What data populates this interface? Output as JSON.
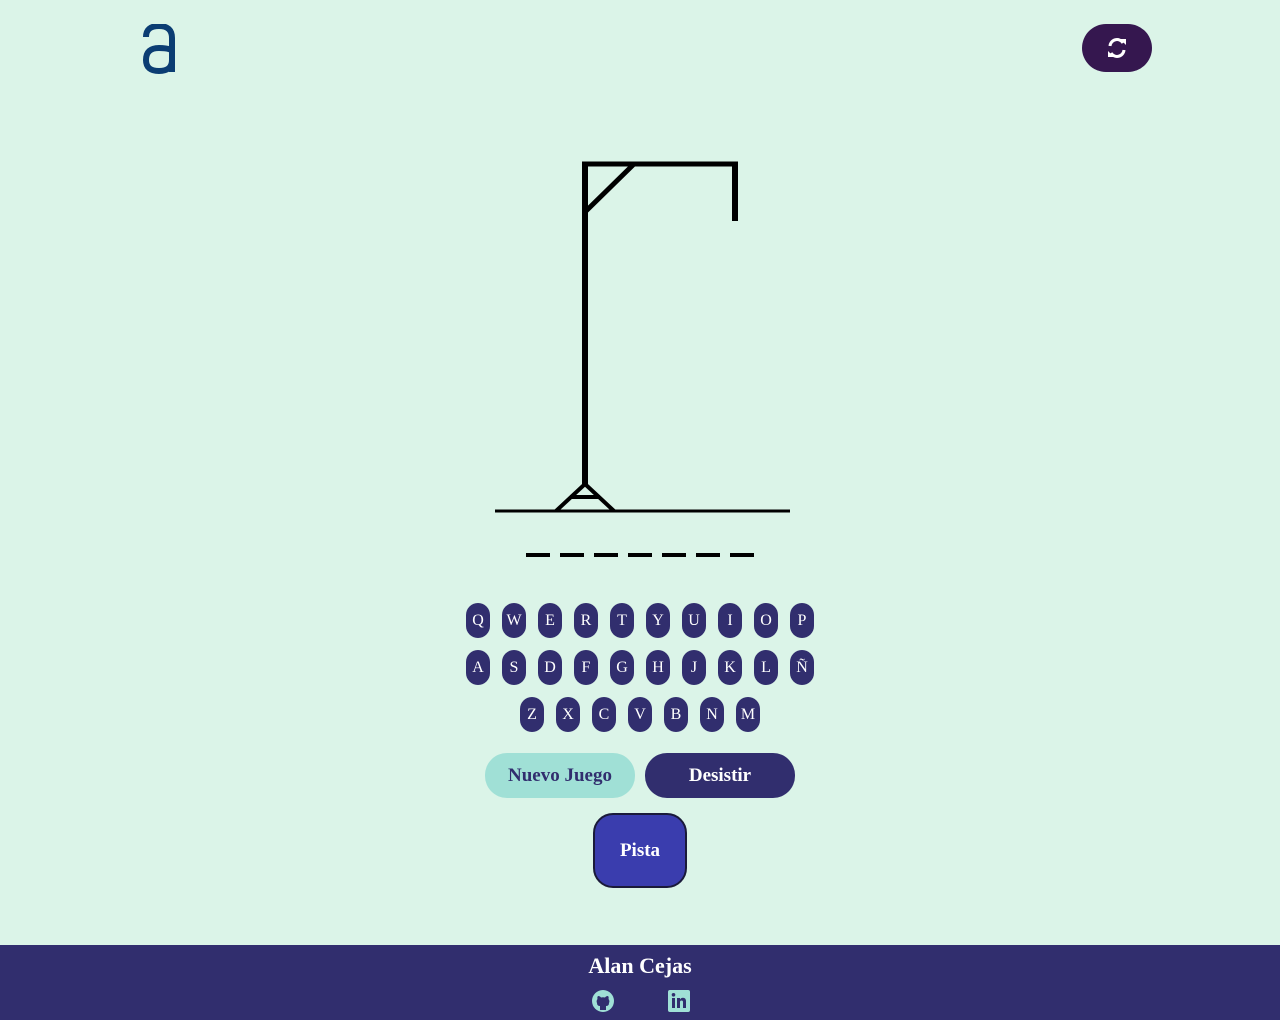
{
  "header": {
    "logo_icon": "alura-logo-icon",
    "reload_icon": "refresh-icon",
    "colors": {
      "logo": "#0b3d73",
      "reload_bg": "#35174f"
    }
  },
  "game": {
    "word_length": 7,
    "gallows_icon": "gallows-drawing",
    "keyboard": {
      "row1": [
        "Q",
        "W",
        "E",
        "R",
        "T",
        "Y",
        "U",
        "I",
        "O",
        "P"
      ],
      "row2": [
        "A",
        "S",
        "D",
        "F",
        "G",
        "H",
        "J",
        "K",
        "L",
        "Ñ"
      ],
      "row3": [
        "Z",
        "X",
        "C",
        "V",
        "B",
        "N",
        "M"
      ]
    },
    "colors": {
      "key_bg": "#312e6e",
      "key_text": "#ffffff",
      "background": "#dbf4e8"
    }
  },
  "actions": {
    "new_game_label": "Nuevo Juego",
    "quit_label": "Desistir",
    "hint_label": "Pista",
    "colors": {
      "new_game_bg": "#a0e0d6",
      "quit_bg": "#312e6e",
      "hint_bg": "#3a3dae"
    }
  },
  "footer": {
    "author": "Alan Cejas",
    "icons": [
      "github-icon",
      "linkedin-icon"
    ],
    "colors": {
      "background": "#312e6e",
      "icon": "#a0e0d6"
    }
  }
}
